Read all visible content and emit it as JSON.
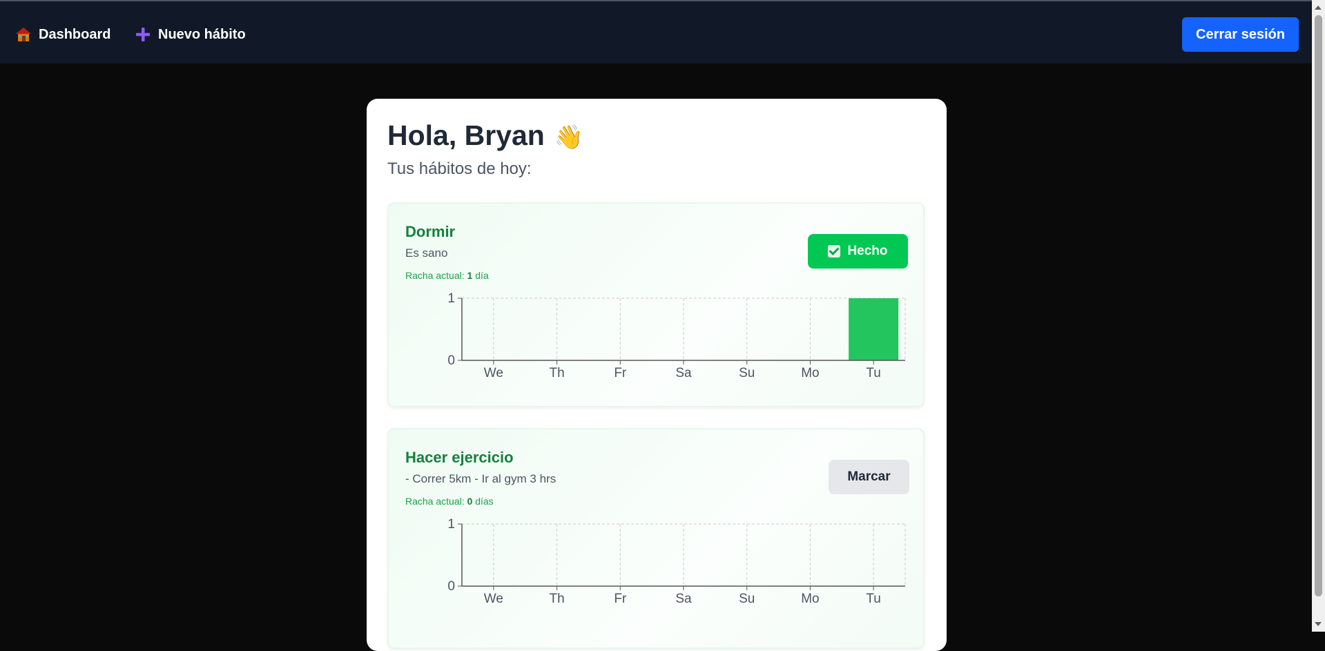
{
  "nav": {
    "dashboard_label": "Dashboard",
    "new_habit_label": "Nuevo hábito",
    "logout_label": "Cerrar sesión"
  },
  "greeting": {
    "title": "Hola, Bryan",
    "wave_emoji": "👋",
    "subtitle": "Tus hábitos de hoy:"
  },
  "habits": [
    {
      "name": "Dormir",
      "description": "Es sano",
      "streak_prefix": "Racha actual:",
      "streak_value": "1",
      "streak_unit": "día",
      "button_label": "Hecho",
      "done": true
    },
    {
      "name": "Hacer ejercicio",
      "description": "- Correr 5km - Ir al gym 3 hrs",
      "streak_prefix": "Racha actual:",
      "streak_value": "0",
      "streak_unit": "días",
      "button_label": "Marcar",
      "done": false
    }
  ],
  "chart_data": [
    {
      "type": "bar",
      "categories": [
        "We",
        "Th",
        "Fr",
        "Sa",
        "Su",
        "Mo",
        "Tu"
      ],
      "values": [
        0,
        0,
        0,
        0,
        0,
        0,
        1
      ],
      "yticks": [
        "0",
        "1"
      ],
      "ylim": [
        0,
        1
      ],
      "grid": true,
      "bar_color": "#22c55e"
    },
    {
      "type": "bar",
      "categories": [
        "We",
        "Th",
        "Fr",
        "Sa",
        "Su",
        "Mo",
        "Tu"
      ],
      "values": [
        0,
        0,
        0,
        0,
        0,
        0,
        0
      ],
      "yticks": [
        "0",
        "1"
      ],
      "ylim": [
        0,
        1
      ],
      "grid": true,
      "bar_color": "#22c55e"
    }
  ],
  "colors": {
    "topbar": "#111827",
    "logout_button": "#1463ff",
    "done_button": "#00c853",
    "habit_title": "#15803d"
  }
}
